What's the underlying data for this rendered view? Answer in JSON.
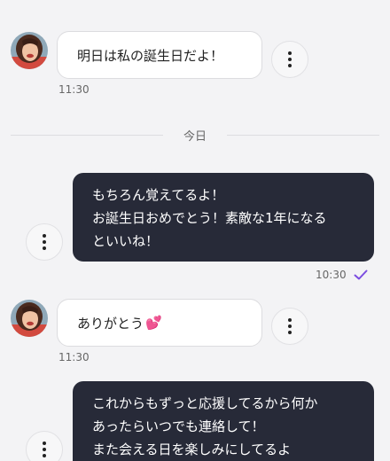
{
  "messages": [
    {
      "direction": "incoming",
      "text": "明日は私の誕生日だよ！",
      "time": "11:30"
    },
    {
      "direction": "outgoing",
      "lines": [
        "もちろん覚えてるよ！",
        "お誕生日おめでとう！素敵な1年になる",
        "といいね！"
      ],
      "time": "10:30",
      "status": "read"
    },
    {
      "direction": "incoming",
      "text": "ありがとう",
      "emoji": "💕",
      "time": "11:30"
    },
    {
      "direction": "outgoing",
      "lines": [
        "これからもずっと応援してるから何か",
        "あったらいつでも連絡して！",
        "また会える日を楽しみにしてるよ"
      ]
    }
  ],
  "date_divider": "今日",
  "icons": {
    "more": "more-vertical-icon",
    "read_receipt": "check-icon",
    "avatar": "contact-avatar"
  },
  "colors": {
    "outgoing_bubble": "#272a38",
    "incoming_bubble": "#ffffff",
    "background": "#f3f3f5",
    "read_check": "#7b4ce0"
  }
}
